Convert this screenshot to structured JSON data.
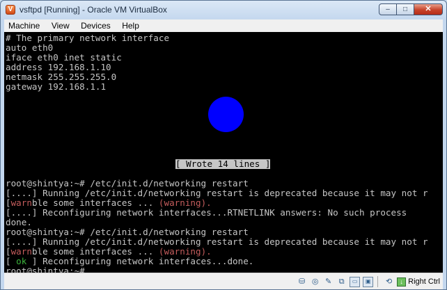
{
  "window": {
    "title": "vsftpd [Running] - Oracle VM VirtualBox"
  },
  "window_controls": {
    "minimize": "–",
    "maximize": "□",
    "close": "✕"
  },
  "menubar": {
    "items": [
      "Machine",
      "View",
      "Devices",
      "Help"
    ]
  },
  "console": {
    "lines": {
      "l0": "# The primary network interface",
      "l1": "auto eth0",
      "l2": "iface eth0 inet static",
      "l3": "address 192.168.1.10",
      "l4": "netmask 255.255.255.0",
      "l5": "gateway 192.168.1.1",
      "l6": "root@shintya:~# /etc/init.d/networking restart",
      "l7": "[....] Running /etc/init.d/networking restart is deprecated because it may not r",
      "l8a": "[",
      "l8b": "warn",
      "l8c": "ble some interfaces ... ",
      "l8d": "(warning).",
      "l9": "[....] Reconfiguring network interfaces...RTNETLINK answers: No such process",
      "l10": "done.",
      "l11": "root@shintya:~# /etc/init.d/networking restart",
      "l12": "[....] Running /etc/init.d/networking restart is deprecated because it may not r",
      "l13a": "[",
      "l13b": "warn",
      "l13c": "ble some interfaces ... ",
      "l13d": "(warning).",
      "l14a": "[ ",
      "l14b": "ok",
      "l14c": " ] Reconfiguring network interfaces...done.",
      "l15": "root@shintya:~# "
    },
    "status_message": "[ Wrote 14 lines ]"
  },
  "statusbar": {
    "host_key": "Right Ctrl"
  },
  "colors": {
    "console_bg": "#000000",
    "console_text": "#c6c6c6",
    "warn_text": "#c45c5c",
    "ok_text": "#3cb33c",
    "blob": "#0000ff"
  }
}
